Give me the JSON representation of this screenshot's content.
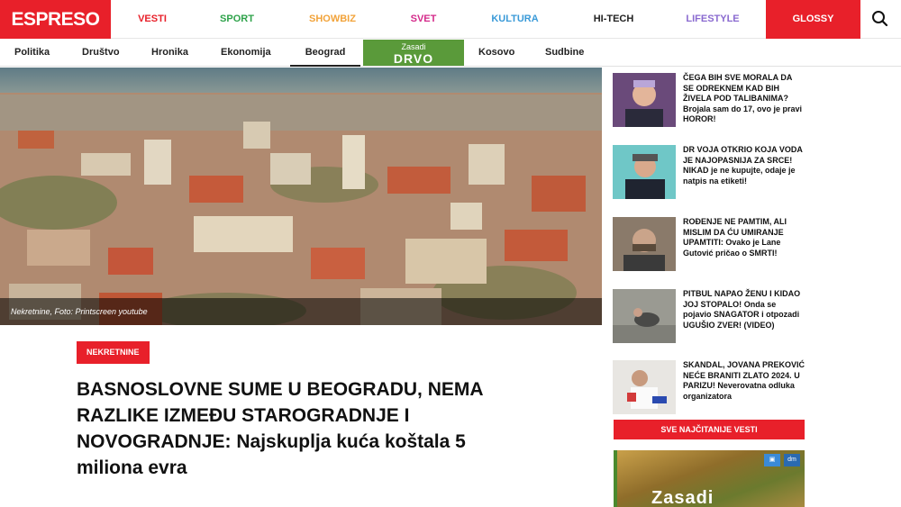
{
  "brand": {
    "logo": "ESPRESO",
    "accent": "#e8202a"
  },
  "nav": {
    "items": [
      {
        "label": "VESTI",
        "color": "#e8202a"
      },
      {
        "label": "SPORT",
        "color": "#2ea24a"
      },
      {
        "label": "SHOWBIZ",
        "color": "#f2a33a"
      },
      {
        "label": "SVET",
        "color": "#d42a8a"
      },
      {
        "label": "KULTURA",
        "color": "#3a9ad8"
      },
      {
        "label": "HI-TECH",
        "color": "#222222"
      },
      {
        "label": "LIFESTYLE",
        "color": "#8a6ad0"
      }
    ],
    "glossy": "GLOSSY",
    "search_icon": "search-icon"
  },
  "subnav": {
    "items": [
      "Politika",
      "Društvo",
      "Hronika",
      "Ekonomija",
      "Beograd",
      "Kosovo",
      "Sudbine"
    ],
    "active": "Beograd",
    "promo": {
      "line1": "Zasadi",
      "line2": "DRVO"
    }
  },
  "hero": {
    "caption": "Nekretnine, Foto: Printscreen youtube"
  },
  "article": {
    "tag": "NEKRETNINE",
    "headline_caps": "BASNOSLOVNE SUME U BEOGRADU, NEMA RAZLIKE IZMEĐU STAROGRADNJE I NOVOGRADNJE:",
    "headline_rest": "Najskuplja kuća koštala 5 miliona evra"
  },
  "sidebar": {
    "stories": [
      {
        "caps": "ČEGA BIH SVE MORALA DA SE ODREKNEM KAD BIH ŽIVELA POD TALIBANIMA?",
        "rest": "Brojala sam do 17, ovo je pravi HOROR!"
      },
      {
        "caps": "DR VOJA OTKRIO KOJA VODA JE NAJOPASNIJA ZA SRCE! NIKAD",
        "rest": "je ne kupujte, odaje je natpis na etiketi!"
      },
      {
        "caps": "ROĐENJE NE PAMTIM, ALI MISLIM DA ĆU UMIRANJE UPAMTITI:",
        "rest": "Ovako je Lane Gutović pričao o SMRTI!"
      },
      {
        "caps": "PITBUL NAPAO ŽENU I KIDAO JOJ STOPALO!",
        "rest": "Onda se pojavio SNAGATOR i otpozadi UGUŠIO ZVER! (VIDEO)"
      },
      {
        "caps": "SKANDAL, JOVANA PREKOVIĆ NEĆE BRANITI ZLATO 2024. U PARIZU!",
        "rest": "Neverovatna odluka organizatora"
      }
    ],
    "more_button": "SVE NAJČITANIJE VESTI",
    "ad_text": "Zasadi"
  }
}
